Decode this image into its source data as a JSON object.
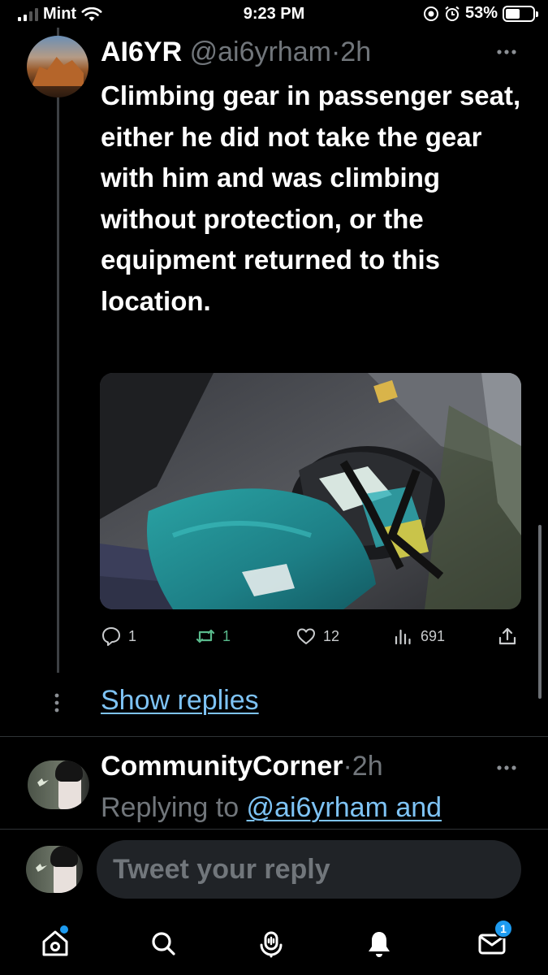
{
  "status_bar": {
    "carrier": "Mint",
    "time": "9:23 PM",
    "battery_percent": "53%",
    "battery_level": 0.53,
    "icons": [
      "signal-icon",
      "wifi-icon",
      "screen-record-icon",
      "alarm-icon",
      "battery-icon"
    ]
  },
  "tweet": {
    "author_name": "AI6YR",
    "author_handle": "@ai6yrham",
    "separator": "·",
    "time_ago": "2h",
    "text": "Climbing gear in passenger seat, either he did not take the gear with him and was climbing without protection, or the equipment returned to this location.",
    "actions": {
      "replies": "1",
      "retweets": "1",
      "likes": "12",
      "views": "691"
    }
  },
  "show_replies_label": "Show replies",
  "reply_tweet": {
    "author_name": "CommunityCorner",
    "separator": "·",
    "time_ago": "2h",
    "replying_prefix": "Replying to ",
    "replying_handle": "@ai6yrham and"
  },
  "compose": {
    "placeholder": "Tweet your reply"
  },
  "bottom_nav": {
    "messages_badge": "1",
    "items": [
      "home-icon",
      "search-icon",
      "spaces-icon",
      "notifications-icon",
      "messages-icon"
    ]
  },
  "colors": {
    "background": "#000000",
    "link": "#7ec3f5",
    "muted": "#71767b",
    "retweet_green": "#59b98b",
    "accent": "#1d9bf0"
  }
}
